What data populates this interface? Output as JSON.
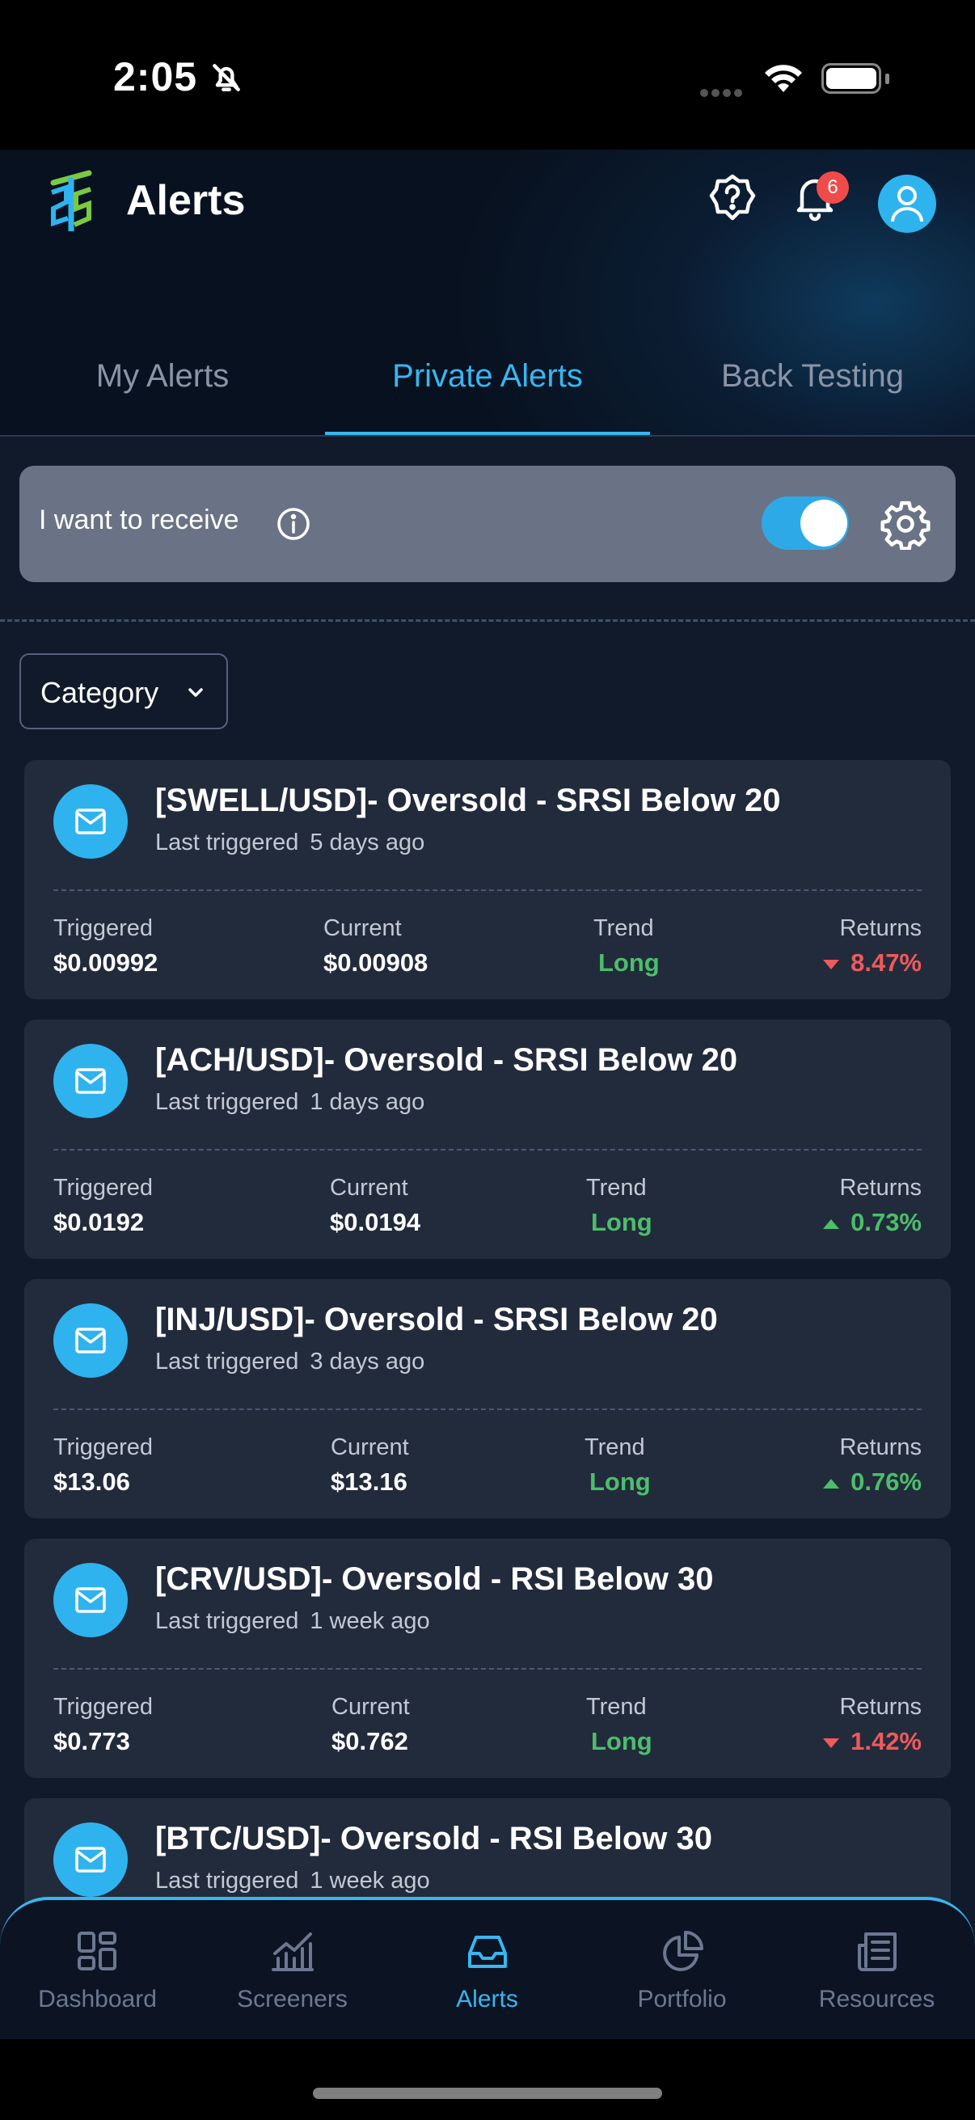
{
  "status_bar": {
    "time": "2:05"
  },
  "header": {
    "title": "Alerts",
    "notification_count": "6"
  },
  "tabs": [
    {
      "label": "My Alerts",
      "active": false
    },
    {
      "label": "Private Alerts",
      "active": true
    },
    {
      "label": "Back Testing",
      "active": false
    }
  ],
  "receive": {
    "label": "I want to receive",
    "toggle_on": true
  },
  "filter": {
    "category_label": "Category"
  },
  "metric_labels": {
    "triggered": "Triggered",
    "current": "Current",
    "trend": "Trend",
    "returns": "Returns"
  },
  "alerts": [
    {
      "title": "[SWELL/USD]- Oversold - SRSI Below 20",
      "last_triggered_label": "Last triggered",
      "ago": "5 days ago",
      "triggered": "$0.00992",
      "current": "$0.00908",
      "trend": "Long",
      "returns": "8.47%",
      "direction": "down"
    },
    {
      "title": "[ACH/USD]- Oversold - SRSI Below 20",
      "last_triggered_label": "Last triggered",
      "ago": "1 days ago",
      "triggered": "$0.0192",
      "current": "$0.0194",
      "trend": "Long",
      "returns": "0.73%",
      "direction": "up"
    },
    {
      "title": "[INJ/USD]- Oversold - SRSI Below 20",
      "last_triggered_label": "Last triggered",
      "ago": "3 days ago",
      "triggered": "$13.06",
      "current": "$13.16",
      "trend": "Long",
      "returns": "0.76%",
      "direction": "up"
    },
    {
      "title": "[CRV/USD]- Oversold - RSI Below 30",
      "last_triggered_label": "Last triggered",
      "ago": "1 week ago",
      "triggered": "$0.773",
      "current": "$0.762",
      "trend": "Long",
      "returns": "1.42%",
      "direction": "down"
    },
    {
      "title": "[BTC/USD]- Oversold - RSI Below 30",
      "last_triggered_label": "Last triggered",
      "ago": "1 week ago"
    }
  ],
  "bottom_nav": [
    {
      "label": "Dashboard",
      "icon": "dashboard-icon",
      "active": false
    },
    {
      "label": "Screeners",
      "icon": "chart-icon",
      "active": false
    },
    {
      "label": "Alerts",
      "icon": "inbox-icon",
      "active": true
    },
    {
      "label": "Portfolio",
      "icon": "pie-chart-icon",
      "active": false
    },
    {
      "label": "Resources",
      "icon": "newspaper-icon",
      "active": false
    }
  ],
  "colors": {
    "accent": "#38b6f0",
    "up": "#4cbe6a",
    "down": "#f05a5a"
  }
}
